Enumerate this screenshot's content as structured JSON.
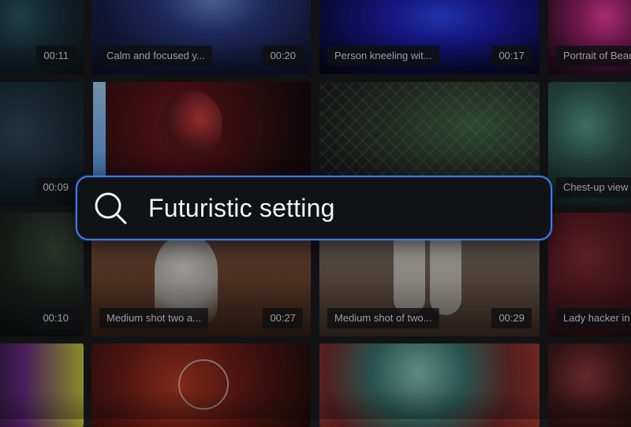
{
  "search": {
    "icon": "search-icon",
    "query": "Futuristic setting"
  },
  "colors": {
    "accent": "#3a7bf0",
    "background": "#17181b",
    "search_bg": "#111215",
    "text": "#f2f3f5"
  },
  "videos": [
    {
      "title": "",
      "duration": "00:11"
    },
    {
      "title": "Calm and focused y...",
      "duration": "00:20"
    },
    {
      "title": "Person kneeling wit...",
      "duration": "00:17"
    },
    {
      "title": "Portrait of Beau",
      "duration": ""
    },
    {
      "title": "",
      "duration": "00:09"
    },
    {
      "title": "",
      "duration": ""
    },
    {
      "title": "",
      "duration": ""
    },
    {
      "title": "Chest-up view t",
      "duration": ""
    },
    {
      "title": "",
      "duration": "00:10"
    },
    {
      "title": "Medium shot two a...",
      "duration": "00:27"
    },
    {
      "title": "Medium shot of two...",
      "duration": "00:29"
    },
    {
      "title": "Lady hacker in",
      "duration": ""
    },
    {
      "title": "",
      "duration": ""
    },
    {
      "title": "",
      "duration": ""
    },
    {
      "title": "",
      "duration": ""
    },
    {
      "title": "",
      "duration": ""
    }
  ]
}
